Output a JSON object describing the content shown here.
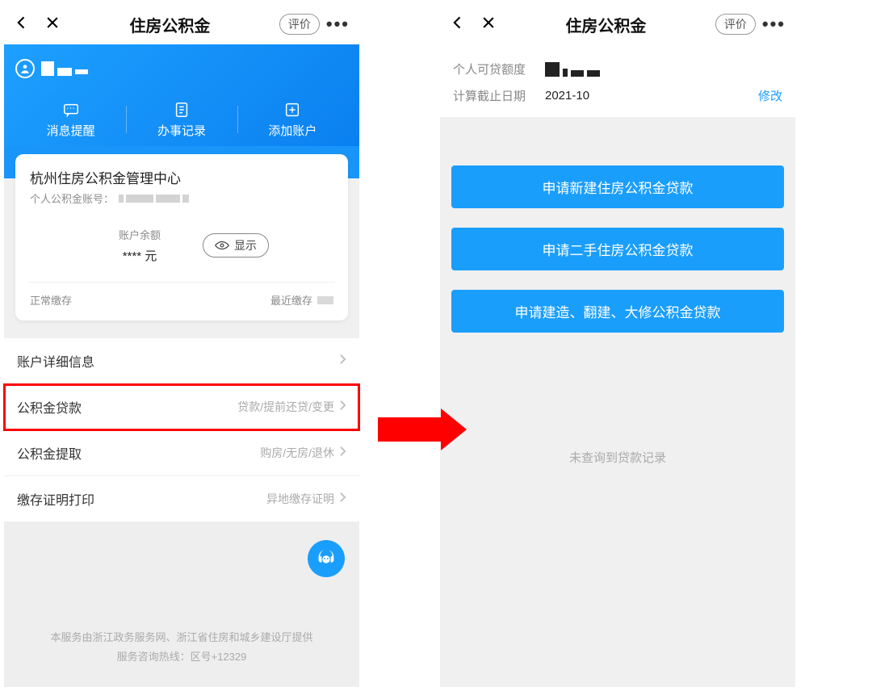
{
  "left": {
    "header": {
      "title": "住房公积金",
      "review_label": "评价"
    },
    "banner": {
      "actions": [
        {
          "label": "消息提醒"
        },
        {
          "label": "办事记录"
        },
        {
          "label": "添加账户"
        }
      ]
    },
    "card": {
      "title": "杭州住房公积金管理中心",
      "account_no_label": "个人公积金账号：",
      "balance_label": "账户余额",
      "balance_value": "**** 元",
      "show_label": "显示",
      "status": "正常缴存",
      "recent_label": "最近缴存"
    },
    "menu": [
      {
        "label": "账户详细信息",
        "hint": ""
      },
      {
        "label": "公积金贷款",
        "hint": "贷款/提前还贷/变更"
      },
      {
        "label": "公积金提取",
        "hint": "购房/无房/退休"
      },
      {
        "label": "缴存证明打印",
        "hint": "异地缴存证明"
      }
    ],
    "footer": {
      "line1": "本服务由浙江政务服务网、浙江省住房和城乡建设厅提供",
      "line2": "服务咨询热线：区号+12329"
    }
  },
  "right": {
    "header": {
      "title": "住房公积金",
      "review_label": "评价"
    },
    "summary": {
      "row1_label": "个人可贷额度",
      "row2_label": "计算截止日期",
      "row2_value": "2021-10",
      "modify": "修改"
    },
    "buttons": [
      "申请新建住房公积金贷款",
      "申请二手住房公积金贷款",
      "申请建造、翻建、大修公积金贷款"
    ],
    "empty": "未查询到贷款记录"
  }
}
